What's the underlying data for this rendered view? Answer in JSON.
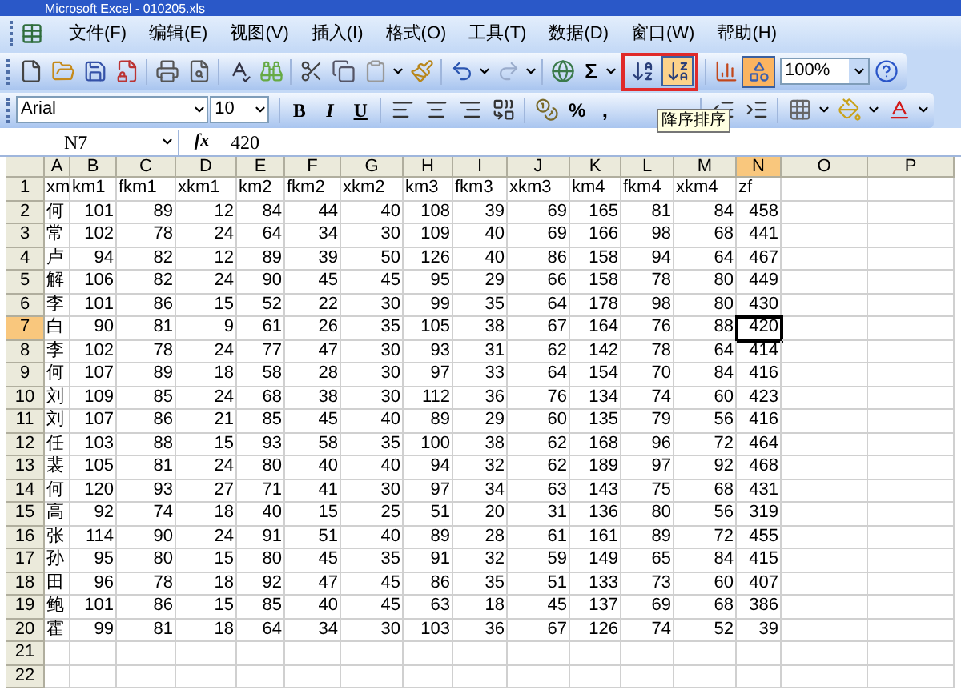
{
  "window": {
    "title": "Microsoft Excel - 010205.xls"
  },
  "menu": [
    {
      "label": "文件(F)"
    },
    {
      "label": "编辑(E)"
    },
    {
      "label": "视图(V)"
    },
    {
      "label": "插入(I)"
    },
    {
      "label": "格式(O)"
    },
    {
      "label": "工具(T)"
    },
    {
      "label": "数据(D)"
    },
    {
      "label": "窗口(W)"
    },
    {
      "label": "帮助(H)"
    }
  ],
  "standard_toolbar": {
    "sum": "Σ",
    "zoom": "100%",
    "sort_buttons": [
      {
        "kind": "ascending",
        "highlighted": false
      },
      {
        "kind": "descending",
        "highlighted": true
      }
    ]
  },
  "formatting_toolbar": {
    "font": "Arial",
    "size": "10",
    "bold": "B",
    "italic": "I",
    "underline": "U",
    "percent": "%",
    "comma": ","
  },
  "tooltip": "降序排序",
  "formula_bar": {
    "name_box": "N7",
    "fx": "fx",
    "value": "420"
  },
  "sheet": {
    "columns": [
      {
        "label": "A",
        "selected": false
      },
      {
        "label": "B",
        "selected": false
      },
      {
        "label": "C",
        "selected": false
      },
      {
        "label": "D",
        "selected": false
      },
      {
        "label": "E",
        "selected": false
      },
      {
        "label": "F",
        "selected": false
      },
      {
        "label": "G",
        "selected": false
      },
      {
        "label": "H",
        "selected": false
      },
      {
        "label": "I",
        "selected": false
      },
      {
        "label": "J",
        "selected": false
      },
      {
        "label": "K",
        "selected": false
      },
      {
        "label": "L",
        "selected": false
      },
      {
        "label": "M",
        "selected": false
      },
      {
        "label": "N",
        "selected": true
      },
      {
        "label": "O",
        "selected": false
      },
      {
        "label": "P",
        "selected": false
      }
    ],
    "rows": [
      {
        "label": "1",
        "selected": false,
        "cells": [
          "xm",
          "km1",
          "fkm1",
          "xkm1",
          "km2",
          "fkm2",
          "xkm2",
          "km3",
          "fkm3",
          "xkm3",
          "km4",
          "fkm4",
          "xkm4",
          "zf"
        ]
      },
      {
        "label": "2",
        "selected": false,
        "cells": [
          "何",
          "101",
          "89",
          "12",
          "84",
          "44",
          "40",
          "108",
          "39",
          "69",
          "165",
          "81",
          "84",
          "458"
        ]
      },
      {
        "label": "3",
        "selected": false,
        "cells": [
          "常",
          "102",
          "78",
          "24",
          "64",
          "34",
          "30",
          "109",
          "40",
          "69",
          "166",
          "98",
          "68",
          "441"
        ]
      },
      {
        "label": "4",
        "selected": false,
        "cells": [
          "卢",
          "94",
          "82",
          "12",
          "89",
          "39",
          "50",
          "126",
          "40",
          "86",
          "158",
          "94",
          "64",
          "467"
        ]
      },
      {
        "label": "5",
        "selected": false,
        "cells": [
          "解",
          "106",
          "82",
          "24",
          "90",
          "45",
          "45",
          "95",
          "29",
          "66",
          "158",
          "78",
          "80",
          "449"
        ]
      },
      {
        "label": "6",
        "selected": false,
        "cells": [
          "李",
          "101",
          "86",
          "15",
          "52",
          "22",
          "30",
          "99",
          "35",
          "64",
          "178",
          "98",
          "80",
          "430"
        ]
      },
      {
        "label": "7",
        "selected": true,
        "cells": [
          "白",
          "90",
          "81",
          "9",
          "61",
          "26",
          "35",
          "105",
          "38",
          "67",
          "164",
          "76",
          "88",
          "420"
        ]
      },
      {
        "label": "8",
        "selected": false,
        "cells": [
          "李",
          "102",
          "78",
          "24",
          "77",
          "47",
          "30",
          "93",
          "31",
          "62",
          "142",
          "78",
          "64",
          "414"
        ]
      },
      {
        "label": "9",
        "selected": false,
        "cells": [
          "何",
          "107",
          "89",
          "18",
          "58",
          "28",
          "30",
          "97",
          "33",
          "64",
          "154",
          "70",
          "84",
          "416"
        ]
      },
      {
        "label": "10",
        "selected": false,
        "cells": [
          "刘",
          "109",
          "85",
          "24",
          "68",
          "38",
          "30",
          "112",
          "36",
          "76",
          "134",
          "74",
          "60",
          "423"
        ]
      },
      {
        "label": "11",
        "selected": false,
        "cells": [
          "刘",
          "107",
          "86",
          "21",
          "85",
          "45",
          "40",
          "89",
          "29",
          "60",
          "135",
          "79",
          "56",
          "416"
        ]
      },
      {
        "label": "12",
        "selected": false,
        "cells": [
          "任",
          "103",
          "88",
          "15",
          "93",
          "58",
          "35",
          "100",
          "38",
          "62",
          "168",
          "96",
          "72",
          "464"
        ]
      },
      {
        "label": "13",
        "selected": false,
        "cells": [
          "裴",
          "105",
          "81",
          "24",
          "80",
          "40",
          "40",
          "94",
          "32",
          "62",
          "189",
          "97",
          "92",
          "468"
        ]
      },
      {
        "label": "14",
        "selected": false,
        "cells": [
          "何",
          "120",
          "93",
          "27",
          "71",
          "41",
          "30",
          "97",
          "34",
          "63",
          "143",
          "75",
          "68",
          "431"
        ]
      },
      {
        "label": "15",
        "selected": false,
        "cells": [
          "高",
          "92",
          "74",
          "18",
          "40",
          "15",
          "25",
          "51",
          "20",
          "31",
          "136",
          "80",
          "56",
          "319"
        ]
      },
      {
        "label": "16",
        "selected": false,
        "cells": [
          "张",
          "114",
          "90",
          "24",
          "91",
          "51",
          "40",
          "89",
          "28",
          "61",
          "161",
          "89",
          "72",
          "455"
        ]
      },
      {
        "label": "17",
        "selected": false,
        "cells": [
          "孙",
          "95",
          "80",
          "15",
          "80",
          "45",
          "35",
          "91",
          "32",
          "59",
          "149",
          "65",
          "84",
          "415"
        ]
      },
      {
        "label": "18",
        "selected": false,
        "cells": [
          "田",
          "96",
          "78",
          "18",
          "92",
          "47",
          "45",
          "86",
          "35",
          "51",
          "133",
          "73",
          "60",
          "407"
        ]
      },
      {
        "label": "19",
        "selected": false,
        "cells": [
          "鲍",
          "101",
          "86",
          "15",
          "85",
          "40",
          "45",
          "63",
          "18",
          "45",
          "137",
          "69",
          "68",
          "386"
        ]
      },
      {
        "label": "20",
        "selected": false,
        "cells": [
          "霍",
          "99",
          "81",
          "18",
          "64",
          "34",
          "30",
          "103",
          "36",
          "67",
          "126",
          "74",
          "52",
          "39"
        ]
      },
      {
        "label": "21",
        "selected": false,
        "cells": []
      },
      {
        "label": "22",
        "selected": false,
        "cells": []
      }
    ]
  }
}
